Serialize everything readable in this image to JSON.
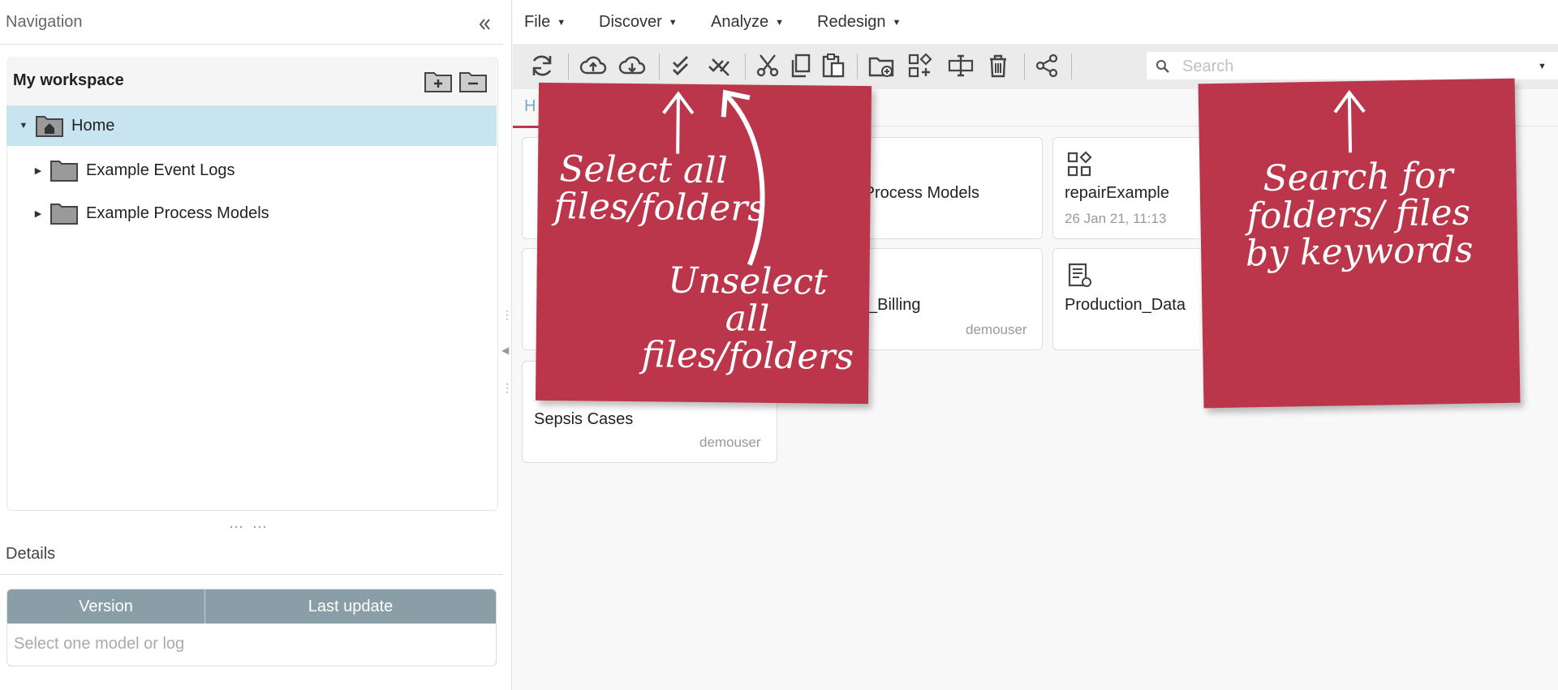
{
  "navigation": {
    "title": "Navigation",
    "collapse_icon": "double-chevron-left-icon",
    "workspace_title": "My workspace",
    "tree": [
      {
        "label": "Home",
        "icon": "home-folder-icon",
        "selected": true
      },
      {
        "label": "Example Event Logs",
        "icon": "folder-icon"
      },
      {
        "label": "Example Process Models",
        "icon": "folder-icon"
      }
    ]
  },
  "details": {
    "title": "Details",
    "columns": [
      "Version",
      "Last update"
    ],
    "empty_text": "Select one model or log"
  },
  "menu": {
    "file": "File",
    "discover": "Discover",
    "analyze": "Analyze",
    "redesign": "Redesign"
  },
  "search": {
    "placeholder": "Search"
  },
  "tab": {
    "home_label": "H"
  },
  "cards": [
    {
      "title": "e Process Models",
      "subtitle": "",
      "owner": ""
    },
    {
      "title": "repairExample",
      "subtitle": "26 Jan 21, 11:13",
      "owner": ""
    },
    {
      "title": "_Billing",
      "subtitle": "",
      "owner": "demouser"
    },
    {
      "title": "Production_Data",
      "subtitle": "",
      "owner": ""
    },
    {
      "title": "Sepsis Cases",
      "subtitle": "",
      "owner": "demouser"
    }
  ],
  "notes": {
    "select_all": "Select all files/folders",
    "unselect_all": "Unselect all files/folders",
    "search": "Search for folders/ files by keywords"
  },
  "colors": {
    "note": "#bc364b",
    "selected_row": "#c9e4f1",
    "table_header": "#8a9ea7",
    "toolbar": "#ebebeb"
  }
}
